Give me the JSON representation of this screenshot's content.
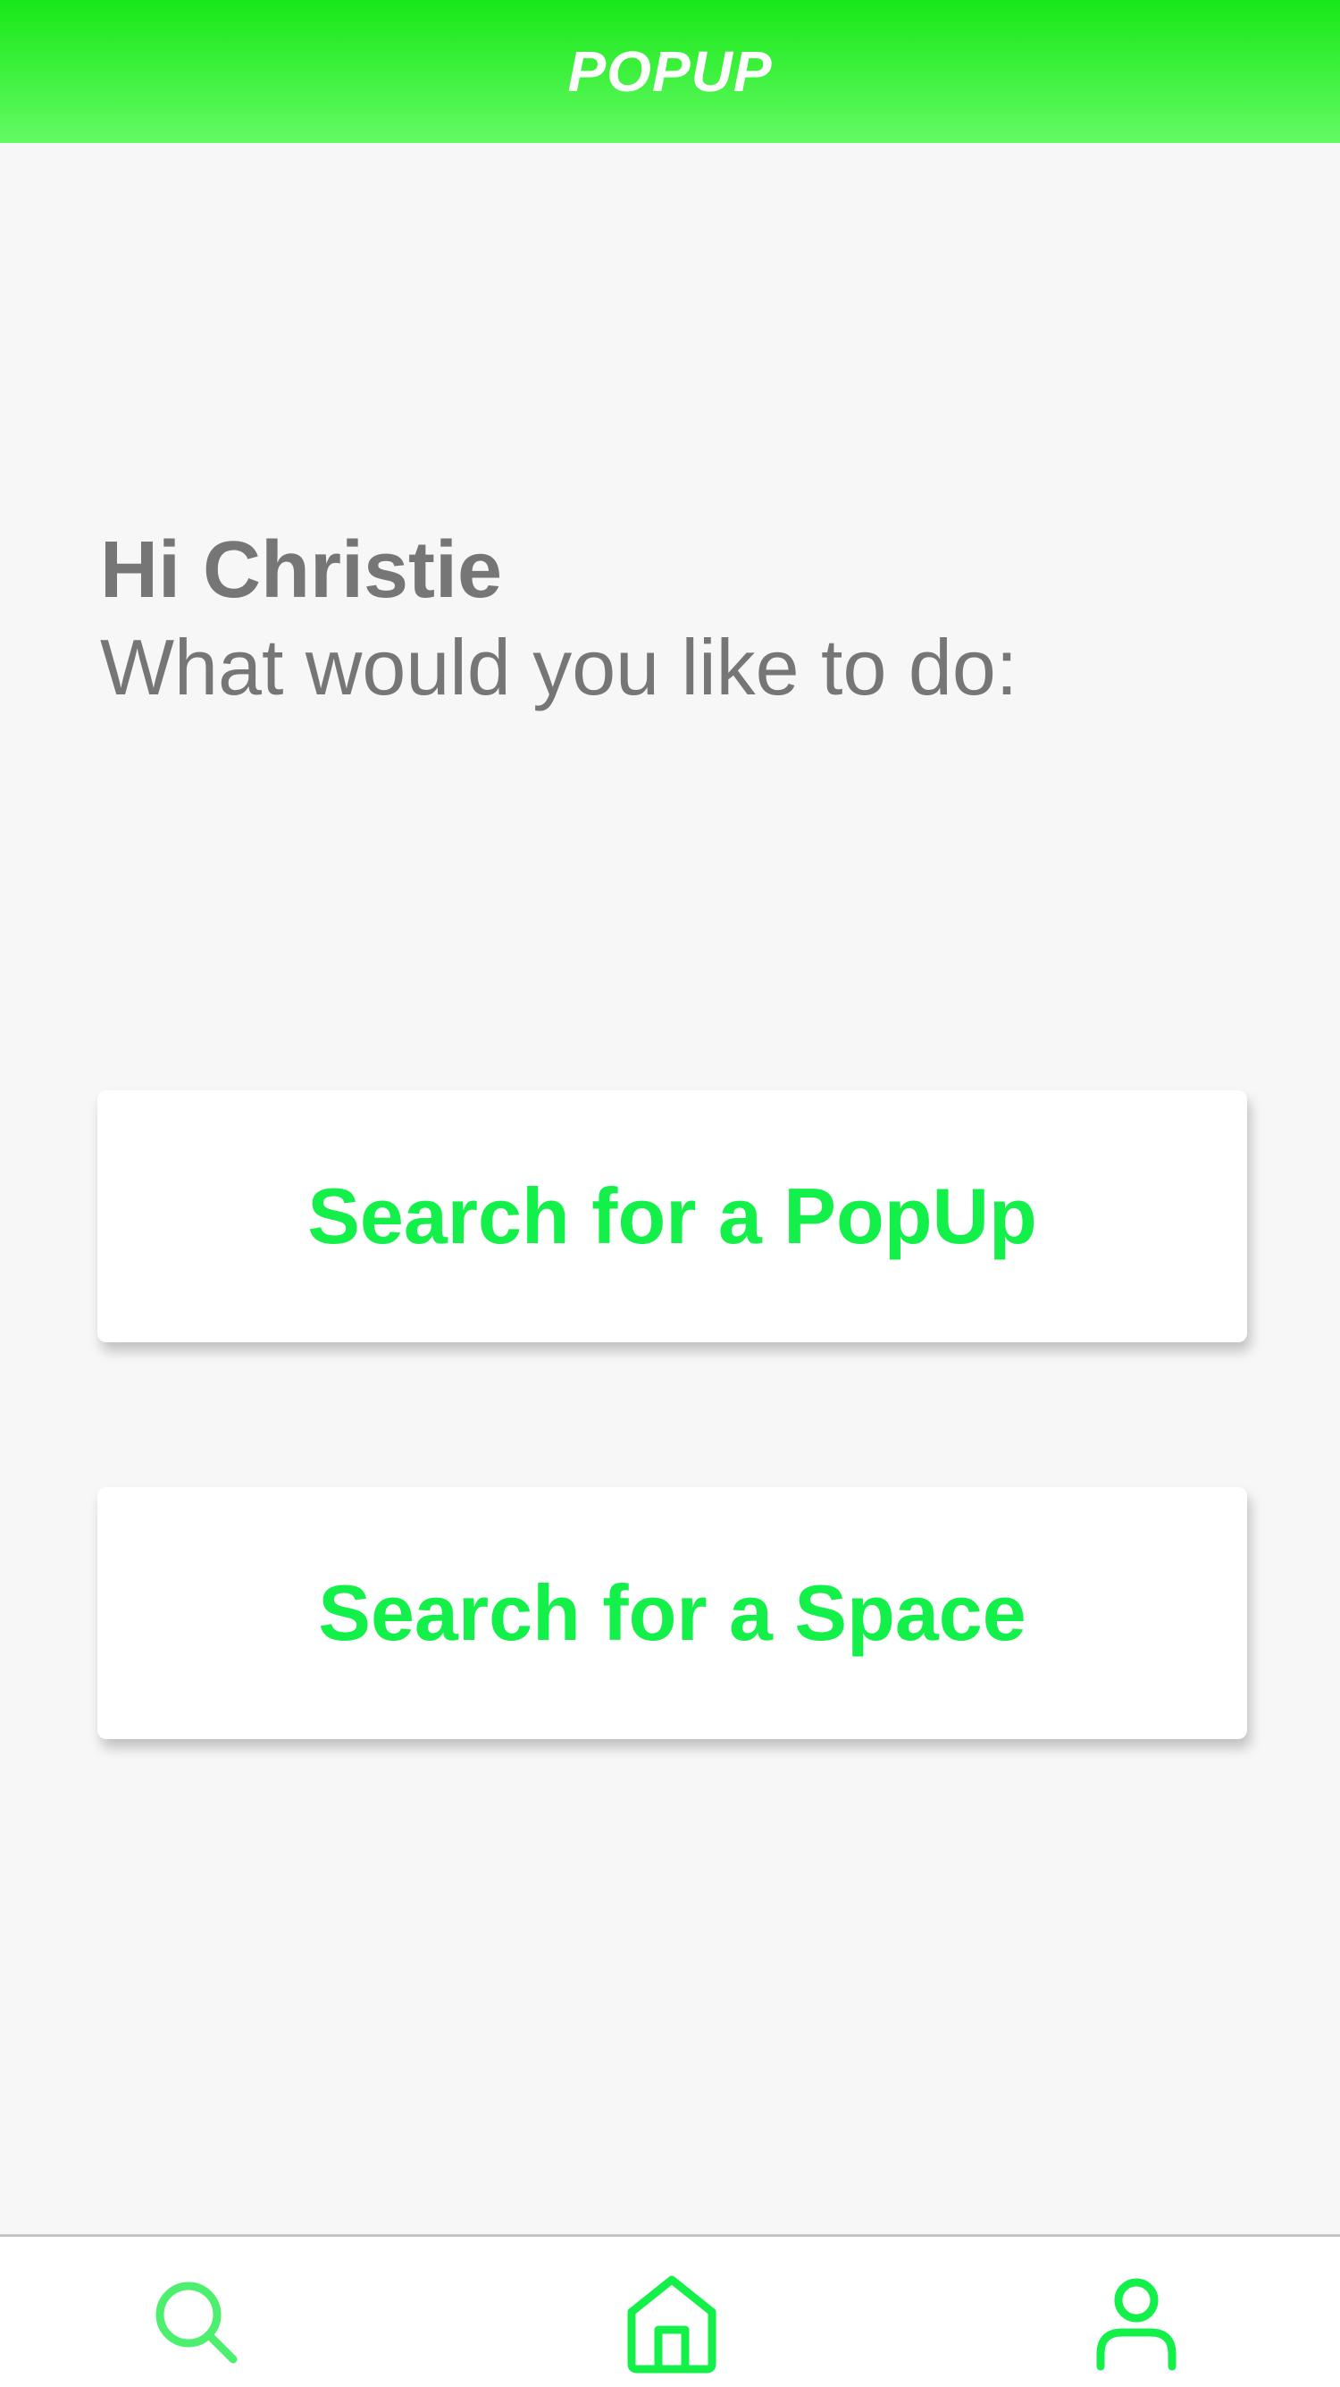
{
  "header": {
    "title": "POPUP"
  },
  "greeting": {
    "name_line": "Hi Christie",
    "prompt": "What would you like to do:"
  },
  "actions": [
    {
      "label": "Search for a PopUp"
    },
    {
      "label": "Search for a Space"
    }
  ],
  "tabbar": {
    "items": [
      {
        "icon": "search-icon",
        "color": "#4df06e"
      },
      {
        "icon": "home-icon",
        "color": "#14f04a"
      },
      {
        "icon": "user-icon",
        "color": "#14f04a"
      }
    ]
  },
  "colors": {
    "header_gradient_top": "#18e818",
    "header_gradient_bottom": "#63fa63",
    "accent": "#14f04a",
    "text_gray": "#767676",
    "background": "#f7f7f7"
  }
}
